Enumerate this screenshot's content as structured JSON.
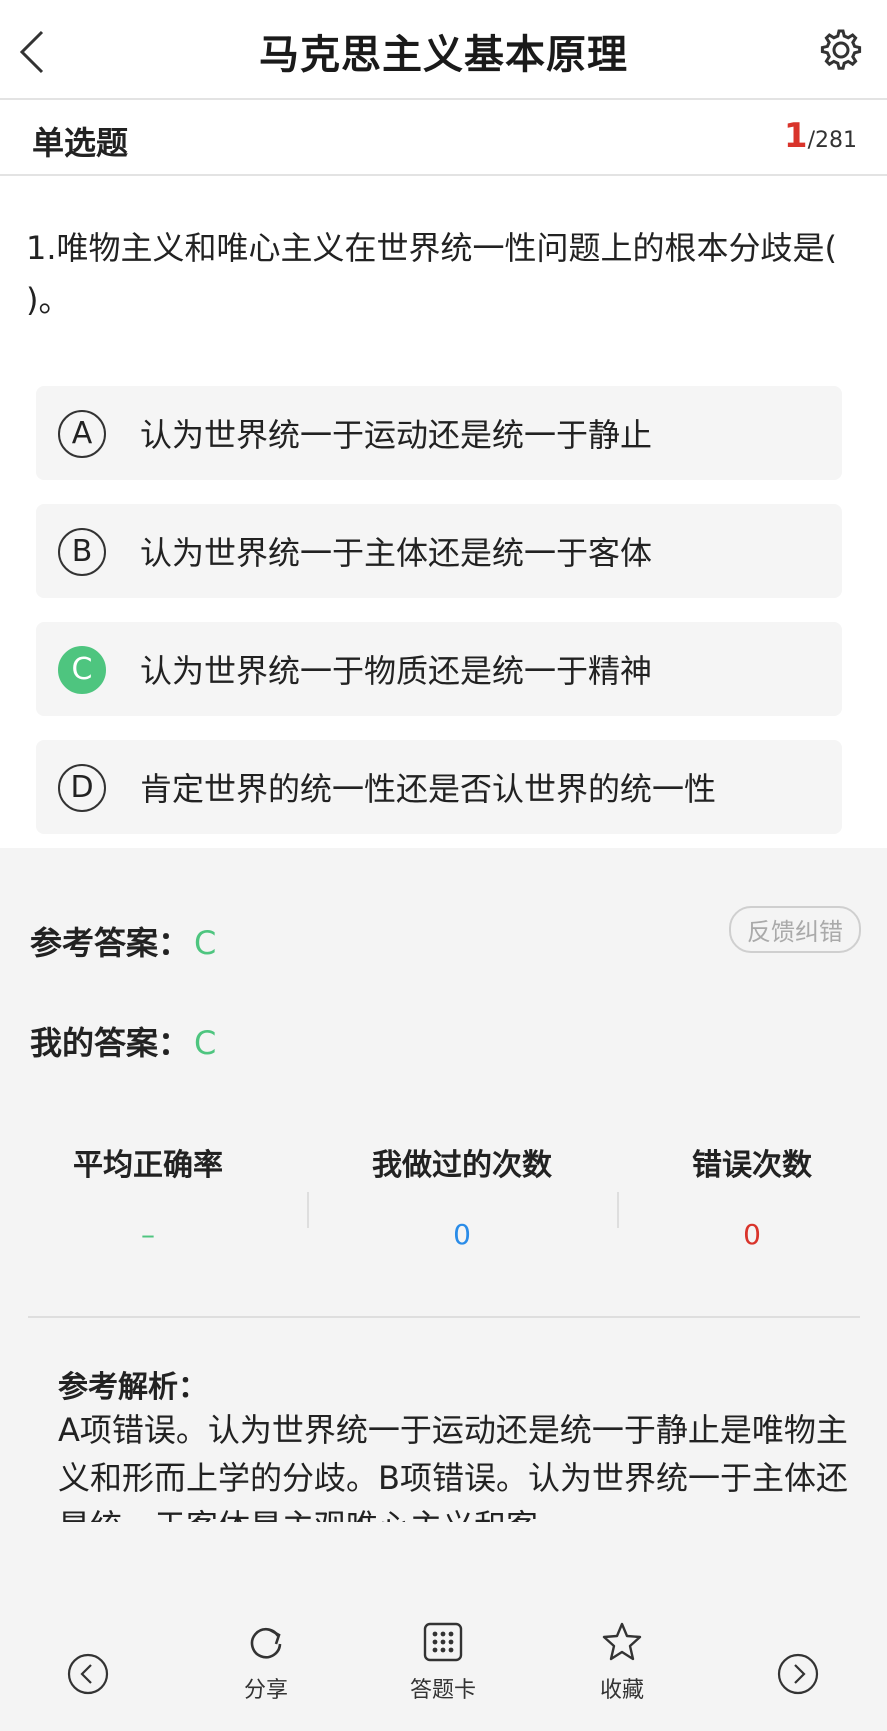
{
  "header": {
    "title": "马克思主义基本原理"
  },
  "type_bar": {
    "type_label": "单选题",
    "current": "1",
    "total": "/281"
  },
  "question": {
    "text": "1.唯物主义和唯心主义在世界统一性问题上的根本分歧是( )。"
  },
  "options": [
    {
      "letter": "A",
      "text": "认为世界统一于运动还是统一于静止",
      "correct": false
    },
    {
      "letter": "B",
      "text": "认为世界统一于主体还是统一于客体",
      "correct": false
    },
    {
      "letter": "C",
      "text": "认为世界统一于物质还是统一于精神",
      "correct": true
    },
    {
      "letter": "D",
      "text": "肯定世界的统一性还是否认世界的统一性",
      "correct": false
    }
  ],
  "answers": {
    "reference_label": "参考答案：",
    "reference_value": "C",
    "mine_label": "我的答案：",
    "mine_value": "C",
    "feedback_label": "反馈纠错"
  },
  "stats": [
    {
      "label": "平均正确率",
      "value": "–",
      "color": "#4ec57f"
    },
    {
      "label": "我做过的次数",
      "value": "0",
      "color": "#2a8ce8"
    },
    {
      "label": "错误次数",
      "value": "0",
      "color": "#d9342b"
    }
  ],
  "analysis": {
    "title": "参考解析：",
    "text": "A项错误。认为世界统一于运动还是统一于静止是唯物主义和形而上学的分歧。B项错误。认为世界统一于主体还是统一于客体是主观唯心主义和客"
  },
  "bottom_nav": {
    "share": "分享",
    "answer_card": "答题卡",
    "favorite": "收藏"
  },
  "colors": {
    "correct_green": "#4ec57f",
    "red": "#d9342b",
    "blue": "#2a8ce8"
  }
}
